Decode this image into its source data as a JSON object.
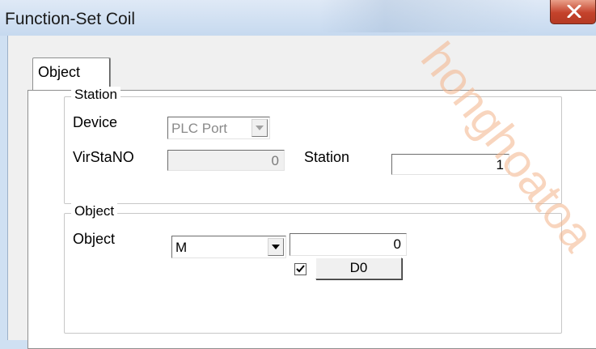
{
  "window": {
    "title": "Function-Set Coil"
  },
  "tabs": [
    {
      "label": "Object"
    }
  ],
  "station_group": {
    "legend": "Station",
    "device_label": "Device",
    "device_value": "PLC Port",
    "virstano_label": "VirStaNO",
    "virstano_value": "0",
    "station_label": "Station",
    "station_value": "1"
  },
  "object_group": {
    "legend": "Object",
    "object_label": "Object",
    "object_type_value": "M",
    "object_address_value": "0",
    "checkbox_checked": true,
    "d0_button_label": "D0"
  },
  "watermark": {
    "text": "honghoatoa"
  }
}
